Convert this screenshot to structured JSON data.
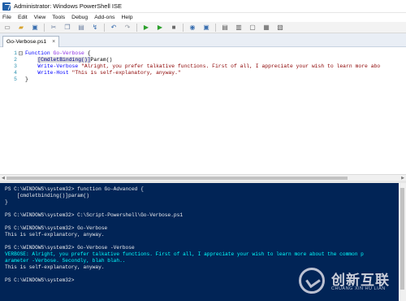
{
  "window": {
    "title": "Administrator: Windows PowerShell ISE"
  },
  "menubar": [
    "File",
    "Edit",
    "View",
    "Tools",
    "Debug",
    "Add-ons",
    "Help"
  ],
  "toolbar_icons": [
    {
      "name": "new-script-icon",
      "glyph": "▭",
      "color": "#6a6a6a"
    },
    {
      "name": "open-script-icon",
      "glyph": "▰",
      "color": "#d8a430"
    },
    {
      "name": "save-script-icon",
      "glyph": "▣",
      "color": "#3a6fb0"
    },
    {
      "name": "cut-icon",
      "glyph": "✂",
      "color": "#6a7fa0"
    },
    {
      "name": "copy-icon",
      "glyph": "❐",
      "color": "#6a7fa0"
    },
    {
      "name": "paste-icon",
      "glyph": "▤",
      "color": "#6a7fa0"
    },
    {
      "name": "clear-console-icon",
      "glyph": "↯",
      "color": "#3a6fb0"
    },
    {
      "name": "undo-icon",
      "glyph": "↶",
      "color": "#3a6fb0"
    },
    {
      "name": "redo-icon",
      "glyph": "↷",
      "color": "#9aa0a8"
    },
    {
      "name": "run-script-icon",
      "glyph": "▶",
      "color": "#2ca02c"
    },
    {
      "name": "run-selection-icon",
      "glyph": "▶",
      "color": "#2ca02c"
    },
    {
      "name": "stop-operation-icon",
      "glyph": "■",
      "color": "#6a6a6a"
    },
    {
      "name": "new-remote-tab-icon",
      "glyph": "◉",
      "color": "#3a6fb0"
    },
    {
      "name": "start-powershell-icon",
      "glyph": "▣",
      "color": "#3a6fb0"
    },
    {
      "name": "show-script-pane-top-icon",
      "glyph": "▤",
      "color": "#5a5a5a"
    },
    {
      "name": "show-script-pane-right-icon",
      "glyph": "▥",
      "color": "#5a5a5a"
    },
    {
      "name": "show-script-pane-maximized-icon",
      "glyph": "▢",
      "color": "#5a5a5a"
    },
    {
      "name": "show-command-window-icon",
      "glyph": "▦",
      "color": "#5a5a5a"
    },
    {
      "name": "show-command-addon-icon",
      "glyph": "▧",
      "color": "#5a5a5a"
    }
  ],
  "tab": {
    "label": "Go-Verbose.ps1",
    "close_glyph": "×"
  },
  "editor": {
    "line_numbers": [
      "1",
      "2",
      "3",
      "4",
      "5"
    ],
    "fold_glyph": "⊟",
    "lines": [
      [
        {
          "t": "Function ",
          "c": "kw"
        },
        {
          "t": "Go-Verbose",
          "c": "fn"
        },
        {
          "t": " {",
          "c": "plain"
        }
      ],
      [
        {
          "t": "    ",
          "c": "plain"
        },
        {
          "t": "[CmdletBinding()]",
          "c": "attr"
        },
        {
          "t": "Param()",
          "c": "plain"
        }
      ],
      [
        {
          "t": "    ",
          "c": "plain"
        },
        {
          "t": "Write-Verbose",
          "c": "cmd"
        },
        {
          "t": " \"Alright, you prefer talkative functions. First of all, I appreciate your wish to learn more abo",
          "c": "str"
        }
      ],
      [
        {
          "t": "    ",
          "c": "plain"
        },
        {
          "t": "Write-Host",
          "c": "cmd"
        },
        {
          "t": " \"This is self-explanatory, anyway.\"",
          "c": "str"
        }
      ],
      [
        {
          "t": "}",
          "c": "plain"
        }
      ]
    ]
  },
  "console": {
    "lines": [
      {
        "t": "PS C:\\WINDOWS\\system32> function Go-Advanced {",
        "v": false
      },
      {
        "t": "    [cmdletbinding()]param()",
        "v": false
      },
      {
        "t": "}",
        "v": false
      },
      {
        "t": "",
        "v": false
      },
      {
        "t": "PS C:\\WINDOWS\\system32> C:\\Script-Powershell\\Go-Verbose.ps1",
        "v": false
      },
      {
        "t": "",
        "v": false
      },
      {
        "t": "PS C:\\WINDOWS\\system32> Go-Verbose",
        "v": false
      },
      {
        "t": "This is self-explanatory, anyway.",
        "v": false
      },
      {
        "t": "",
        "v": false
      },
      {
        "t": "PS C:\\WINDOWS\\system32> Go-Verbose -Verbose",
        "v": false
      },
      {
        "t": "VERBOSE: Alright, you prefer talkative functions. First of all, I appreciate your wish to learn more about the common p",
        "v": true
      },
      {
        "t": "arameter -Verbose. Secondly, blah blah..",
        "v": true
      },
      {
        "t": "This is self-explanatory, anyway.",
        "v": false
      },
      {
        "t": "",
        "v": false
      },
      {
        "t": "PS C:\\WINDOWS\\system32>",
        "v": false
      }
    ]
  },
  "watermark": {
    "cn": "创新互联",
    "en": "CHUANG XIN HU LIAN"
  },
  "colors": {
    "console_bg": "#012456",
    "verbose": "#00ffff",
    "console_fg": "#eeedf0"
  }
}
